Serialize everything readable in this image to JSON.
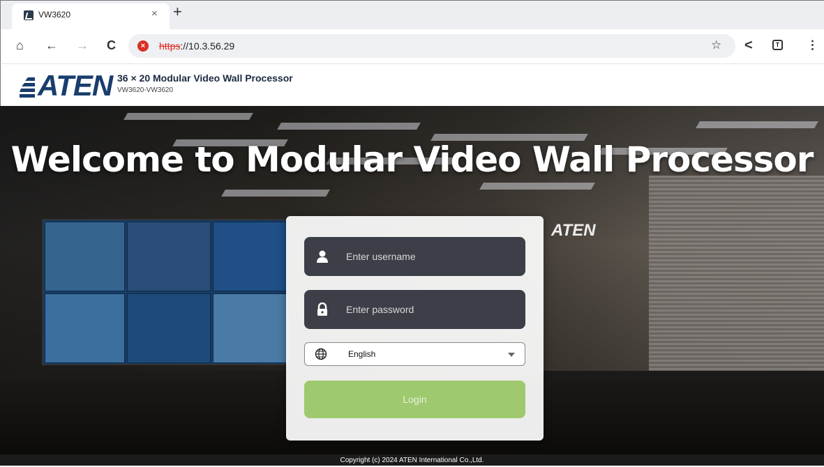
{
  "browser": {
    "tab_title": "VW3620",
    "tab_close": "×",
    "new_tab": "+",
    "url_scheme": "https",
    "url_rest": "://10.3.56.29",
    "nav_home": "⌂",
    "nav_back": "←",
    "nav_forward": "→",
    "nav_reload": "C",
    "bookmark": "☆",
    "share": "<",
    "menu": "⋮"
  },
  "header": {
    "logo_text": "ATEN",
    "product_title": "36 × 20 Modular Video Wall Processor",
    "product_subtitle": "VW3620-VW3620"
  },
  "hero": {
    "welcome": "Welcome to Modular Video Wall Processor",
    "sign": "ATEN"
  },
  "login": {
    "username_placeholder": "Enter username",
    "password_placeholder": "Enter password",
    "language_value": "English",
    "login_label": "Login"
  },
  "footer": {
    "copyright": "Copyright (c) 2024 ATEN International Co.,Ltd."
  },
  "colors": {
    "field_bg": "#3c3f47",
    "login_btn": "#9ec96e",
    "brand": "#1a3d6d",
    "insecure": "#d93025"
  },
  "icons": {
    "username": "user-icon",
    "password": "lock-icon",
    "language": "globe-icon"
  }
}
